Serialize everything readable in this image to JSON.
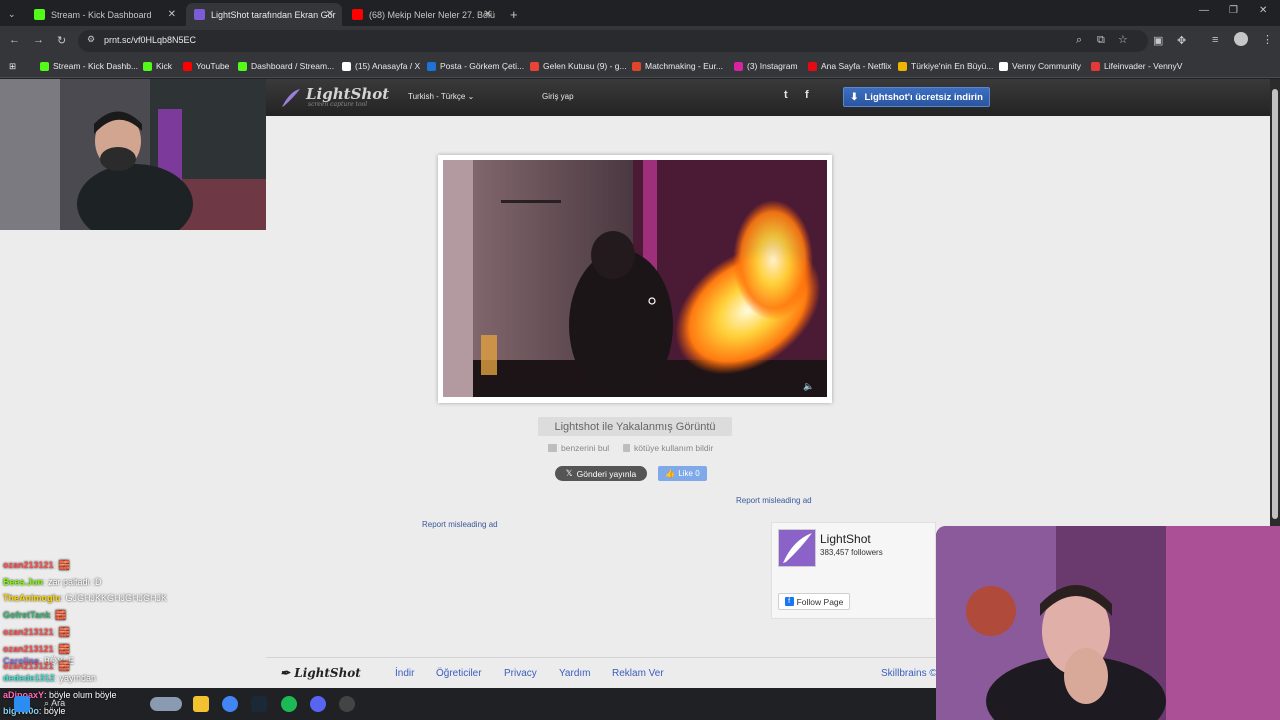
{
  "tabs": [
    {
      "title": "Stream - Kick Dashboard",
      "fav_color": "#53fc18"
    },
    {
      "title": "LightShot tarafından Ekran Gör",
      "fav_color": "#7b5bd6"
    },
    {
      "title": "(68) Mekip Neler Neler 27. Bölü",
      "fav_color": "#ff0000"
    }
  ],
  "address": {
    "url": "prnt.sc/vf0HLqb8N5EC"
  },
  "bookmarks": [
    {
      "label": "Stream - Kick Dashb...",
      "color": "#53fc18"
    },
    {
      "label": "Kick",
      "color": "#53fc18"
    },
    {
      "label": "YouTube",
      "color": "#ff0000"
    },
    {
      "label": "Dashboard / Stream...",
      "color": "#53fc18"
    },
    {
      "label": "(15) Anasayfa / X",
      "color": "#ffffff"
    },
    {
      "label": "Posta - Görkem Çeti...",
      "color": "#1e73d8"
    },
    {
      "label": "Gelen Kutusu (9) - g...",
      "color": "#ea4335"
    },
    {
      "label": "Matchmaking - Eur...",
      "color": "#e0452b"
    },
    {
      "label": "(3) Instagram",
      "color": "#d6249f"
    },
    {
      "label": "Ana Sayfa - Netflix",
      "color": "#e50914"
    },
    {
      "label": "Türkiye'nin En Büyü...",
      "color": "#f0b400"
    },
    {
      "label": "Venny Community",
      "color": "#ffffff"
    },
    {
      "label": "Lifeinvader - VennyV",
      "color": "#e53935"
    }
  ],
  "lightshot": {
    "logo": "LightShot",
    "logo_sub": "screen capture tool",
    "language": "Turkish - Türkçe",
    "login": "Giriş yap",
    "twitter_icon": "t",
    "facebook_icon": "f",
    "download": "Lightshot'ı ücretsiz indirin",
    "caption": "Lightshot ile Yakalanmış Görüntü",
    "similar": "benzerini bul",
    "report_abuse": "kötüye kullanım bildir",
    "tweet": "Gönderi yayınla",
    "like": "Like 0",
    "report_ad_1": "Report misleading ad",
    "report_ad_2": "Report misleading ad",
    "fb_name": "LightShot",
    "fb_followers": "383,457 followers",
    "fb_follow": "Follow Page",
    "footer_logo": "LightShot",
    "footer_links": [
      "İndir",
      "Öğreticiler",
      "Privacy",
      "Yardım",
      "Reklam Ver"
    ],
    "footer_right": "Skillbrains ©"
  },
  "chat": [
    {
      "user": "ozan213121",
      "color": "#ff4d4d",
      "msg": ": 🧱"
    },
    {
      "user": "Bees.Jun",
      "color": "#7cfc00",
      "msg": ": zar paltadı :D"
    },
    {
      "user": "TheAnimoglu",
      "color": "#ffd700",
      "msg": ": GJGHJKKGHJGHJGHJK"
    },
    {
      "user": "GofretTank",
      "color": "#3cb371",
      "msg": ": 🧱"
    },
    {
      "user": "ozan213121",
      "color": "#ff4d4d",
      "msg": ": 🧱"
    },
    {
      "user": "ozan213121",
      "color": "#ff4d4d",
      "msg": ": 🧱"
    },
    {
      "user": "Caroline",
      "color": "#9370db",
      "msg": ": BÖYLE"
    },
    {
      "user": "ozan213121",
      "color": "#ff4d4d",
      "msg": ": 🧱"
    },
    {
      "user": "dedede1312",
      "color": "#40e0d0",
      "msg": ": yayından"
    },
    {
      "user": "aDipoaxY",
      "color": "#ff69b4",
      "msg": ": böyle olum böyle"
    },
    {
      "user": "bigTw0o",
      "color": "#87ceeb",
      "msg": ": böyle"
    }
  ],
  "taskbar": {
    "search": "Ara"
  }
}
